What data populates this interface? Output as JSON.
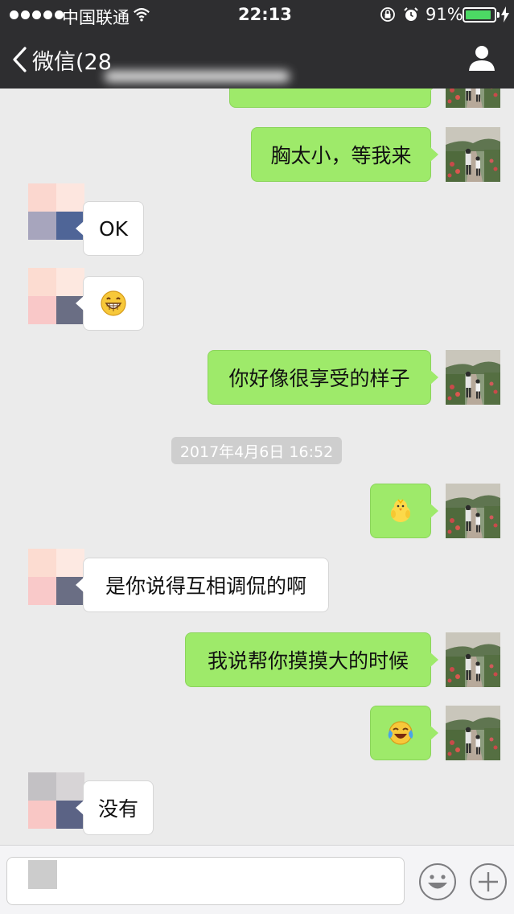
{
  "status_bar": {
    "carrier": "中国联通",
    "time": "22:13",
    "battery_percent": "91%",
    "battery_level": 0.91,
    "icons": [
      "signal-dots-icon",
      "wifi-icon",
      "orientation-lock-icon",
      "alarm-icon",
      "battery-icon",
      "charging-bolt-icon"
    ]
  },
  "nav": {
    "back_label": "微信(28",
    "back_icon": "chevron-left-icon",
    "profile_icon": "person-icon"
  },
  "messages": [
    {
      "sender": "me",
      "text": "胸太小，等我来"
    },
    {
      "sender": "other",
      "text": "OK"
    },
    {
      "sender": "other",
      "emoji": "grinning-face-icon"
    },
    {
      "sender": "me",
      "text": "你好像很享受的样子"
    },
    {
      "sender": "me",
      "emoji": "chick-icon"
    },
    {
      "sender": "other",
      "text": "是你说得互相调侃的啊"
    },
    {
      "sender": "me",
      "text": "我说帮你摸摸大的时候"
    },
    {
      "sender": "me",
      "emoji": "crying-laughing-face-icon"
    },
    {
      "sender": "other",
      "text": "没有"
    }
  ],
  "timestamp": "2017年4月6日 16:52",
  "colors": {
    "nav_background": "#2e2e30",
    "chat_background": "#ebebeb",
    "my_bubble": "#9eea6a",
    "other_bubble": "#ffffff",
    "battery_fill": "#4cd964"
  },
  "input_bar": {
    "emoji_button_icon": "smiley-icon",
    "plus_button_icon": "plus-icon"
  }
}
